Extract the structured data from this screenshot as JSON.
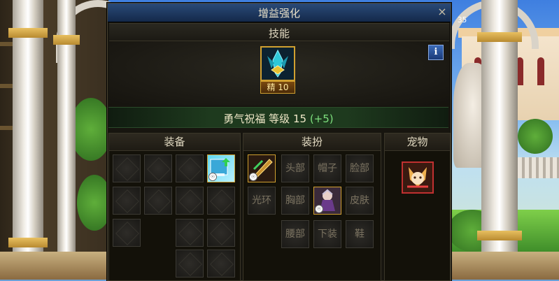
{
  "dialog": {
    "title": "增益强化",
    "close_glyph": "×"
  },
  "skill": {
    "section_title": "技能",
    "info_glyph": "i",
    "badge": "精 10",
    "name": "勇气祝福",
    "level_label": "等级",
    "level": "15",
    "bonus": "(+5)"
  },
  "equipment": {
    "title": "装备"
  },
  "avatar": {
    "title": "装扮",
    "slots": {
      "head": "头部",
      "hat": "帽子",
      "face": "脸部",
      "aura": "光环",
      "chest": "胸部",
      "skin": "皮肤",
      "waist": "腰部",
      "pants": "下装",
      "shoes": "鞋"
    }
  },
  "pet": {
    "title": "宠物"
  },
  "colors": {
    "title_bar": "#14294a",
    "skill_border": "#d0a030",
    "bonus_text": "#7ee07e",
    "panel_bg": "#131109"
  },
  "background": {
    "corner_text": "35"
  }
}
